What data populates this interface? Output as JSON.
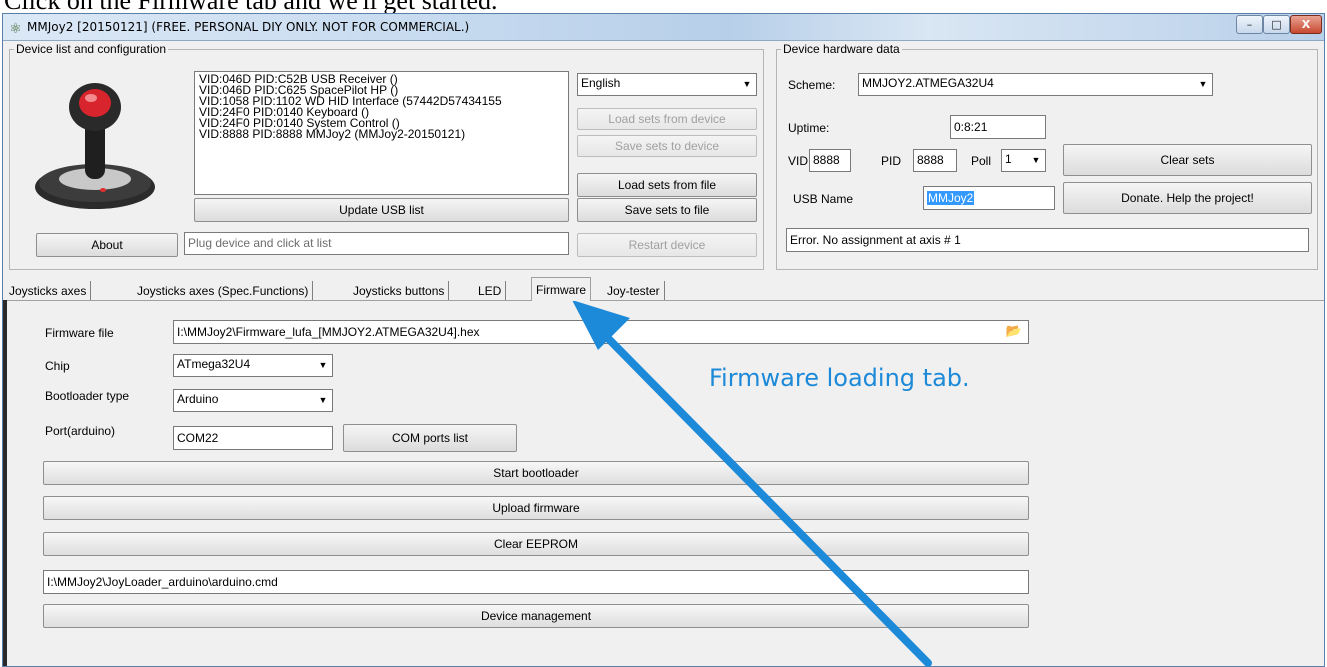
{
  "caption": "Click on the Firmware tab and we'll get started.",
  "window": {
    "title": "MMJoy2 [20150121] (FREE. PERSONAL DIY ONLY. NOT FOR COMMERCIAL.)",
    "icon": "joystick-icon",
    "minimize_glyph": "–",
    "maximize_glyph": "□",
    "close_glyph": "X"
  },
  "device_group": {
    "title": "Device list and configuration",
    "devices": [
      "VID:046D PID:C52B USB Receiver ()",
      "VID:046D PID:C625 SpacePilot HP ()",
      "VID:1058 PID:1102 WD HID Interface (57442D57434155",
      "VID:24F0 PID:0140 Keyboard ()",
      "VID:24F0 PID:0140 System Control ()",
      "VID:8888 PID:8888 MMJoy2 (MMJoy2-20150121)"
    ],
    "language": "English",
    "load_from_device": "Load sets from device",
    "save_to_device": "Save sets to device",
    "load_from_file": "Load sets from file",
    "save_to_file": "Save sets to file",
    "update_usb": "Update USB list",
    "about": "About",
    "status_placeholder": "Plug device and click at list",
    "restart": "Restart device"
  },
  "hardware_group": {
    "title": "Device hardware data",
    "scheme_label": "Scheme:",
    "scheme_value": "MMJOY2.ATMEGA32U4",
    "uptime_label": "Uptime:",
    "uptime_value": "0:8:21",
    "vid_label": "VID",
    "vid_value": "8888",
    "pid_label": "PID",
    "pid_value": "8888",
    "poll_label": "Poll",
    "poll_value": "1",
    "usb_name_label": "USB Name",
    "usb_name_value": "MMJoy2",
    "clear_sets": "Clear sets",
    "donate": "Donate. Help the project!",
    "error_text": "Error. No assignment at axis # 1"
  },
  "tabs": [
    {
      "label": "Joysticks axes",
      "active": false
    },
    {
      "label": "Joysticks axes (Spec.Functions)",
      "active": false
    },
    {
      "label": "Joysticks buttons",
      "active": false
    },
    {
      "label": "LED",
      "active": false
    },
    {
      "label": "Firmware",
      "active": true
    },
    {
      "label": "Joy-tester",
      "active": false
    }
  ],
  "firmware": {
    "file_label": "Firmware file",
    "file_value": "I:\\MMJoy2\\Firmware_lufa_[MMJOY2.ATMEGA32U4].hex",
    "open_icon": "folder-open-icon",
    "chip_label": "Chip",
    "chip_value": "ATmega32U4",
    "bootloader_label": "Bootloader type",
    "bootloader_value": "Arduino",
    "port_label": "Port(arduino)",
    "port_value": "COM22",
    "com_ports": "COM ports list",
    "start_bootloader": "Start bootloader",
    "upload_firmware": "Upload firmware",
    "clear_eeprom": "Clear EEPROM",
    "loader_path": "I:\\MMJoy2\\JoyLoader_arduino\\arduino.cmd",
    "device_management": "Device management"
  },
  "annotation": {
    "text": "Firmware loading tab.",
    "color": "#1c8ad8"
  }
}
